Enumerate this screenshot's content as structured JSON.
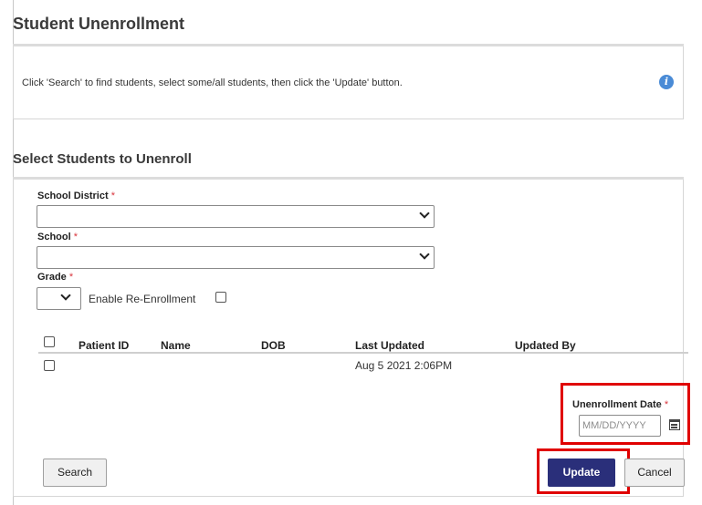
{
  "page": {
    "title": "Student Unenrollment",
    "info_text": "Click 'Search' to find students, select some/all students, then click the 'Update' button.",
    "info_icon": "info-icon"
  },
  "section": {
    "title": "Select Students to Unenroll"
  },
  "form": {
    "school_district": {
      "label": "School District",
      "required_mark": "*",
      "value": ""
    },
    "school": {
      "label": "School",
      "required_mark": "*",
      "value": ""
    },
    "grade": {
      "label": "Grade",
      "required_mark": "*",
      "value": ""
    },
    "re_enrollment": {
      "label": "Enable Re-Enrollment",
      "checked": false
    }
  },
  "table": {
    "headers": [
      "Patient ID",
      "Name",
      "DOB",
      "Last Updated",
      "Updated By"
    ],
    "rows": [
      {
        "patient_id": "",
        "name": "",
        "dob": "",
        "last_updated": "Aug 5 2021 2:06PM",
        "updated_by": ""
      }
    ]
  },
  "unenrollment_date": {
    "label": "Unenrollment Date",
    "required_mark": "*",
    "placeholder": "MM/DD/YYYY",
    "value": ""
  },
  "buttons": {
    "search": "Search",
    "update": "Update",
    "cancel": "Cancel"
  },
  "colors": {
    "primary": "#2a2f7a",
    "highlight": "#e00000",
    "required": "#d9363e",
    "info": "#4a8bd6"
  }
}
